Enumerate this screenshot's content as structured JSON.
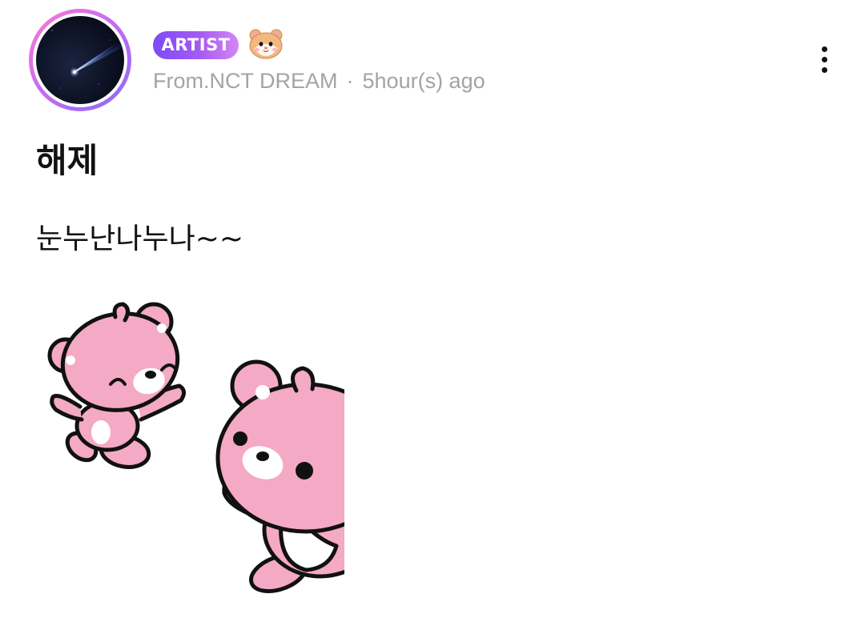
{
  "post": {
    "badge_label": "ARTIST",
    "author_emoji": "hamster-face",
    "from_label": "From.NCT DREAM",
    "separator": "·",
    "time_ago": "5hour(s) ago",
    "title": "해제",
    "body": "눈누난나누나~~",
    "sticker": "pink-bears-sticker"
  },
  "colors": {
    "badge_start": "#7b4cf6",
    "badge_end": "#d486f4",
    "avatar_ring": "#c86cf2",
    "meta_text": "#a3a3a8",
    "bear_pink": "#f4a9c4",
    "text": "#111111"
  },
  "icons": {
    "more": "more-vertical-icon",
    "avatar_image": "shooting-star-night-sky"
  }
}
